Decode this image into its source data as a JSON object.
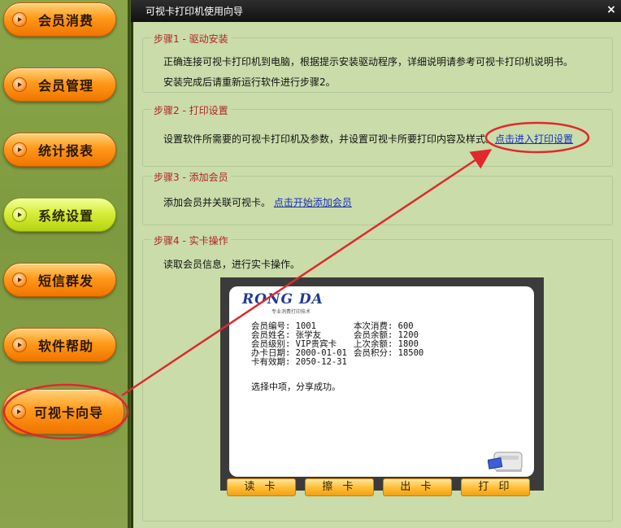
{
  "window": {
    "title": "可视卡打印机使用向导",
    "close_label": "×"
  },
  "sidebar": {
    "items": [
      {
        "label": "会员消费"
      },
      {
        "label": "会员管理"
      },
      {
        "label": "统计报表"
      },
      {
        "label": "系统设置"
      },
      {
        "label": "短信群发"
      },
      {
        "label": "软件帮助"
      },
      {
        "label": "可视卡向导"
      }
    ]
  },
  "steps": [
    {
      "title": "步骤1 - 驱动安装",
      "lines": [
        "正确连接可视卡打印机到电脑，根据提示安装驱动程序，详细说明请参考可视卡打印机说明书。",
        "安装完成后请重新运行软件进行步骤2。"
      ]
    },
    {
      "title": "步骤2 - 打印设置",
      "text": "设置软件所需要的可视卡打印机及参数，并设置可视卡所要打印内容及样式。",
      "link": "点击进入打印设置"
    },
    {
      "title": "步骤3 - 添加会员",
      "text": "添加会员并关联可视卡。",
      "link": "点击开始添加会员"
    },
    {
      "title": "步骤4 - 实卡操作",
      "text": "读取会员信息，进行实卡操作。"
    }
  ],
  "card": {
    "logo": "RONG DA",
    "tagline": "专业消费打印技术",
    "fields": [
      [
        "会员编号: 1001",
        "本次消费: 600"
      ],
      [
        "会员姓名: 张学友",
        "会员余额: 1200"
      ],
      [
        "会员级别: VIP贵宾卡",
        "上次余额: 1800"
      ],
      [
        "办卡日期: 2000-01-01",
        "会员积分: 18500"
      ],
      [
        "卡有效期: 2050-12-31",
        ""
      ]
    ],
    "message": "选择中项，分享成功。"
  },
  "actions": {
    "read": "读 卡",
    "erase": "擦 卡",
    "eject": "出 卡",
    "print": "打 印"
  },
  "colors": {
    "accent_red": "#b0232a",
    "link_blue": "#1a2fbe",
    "panel_bg": "#c9dcaa"
  }
}
